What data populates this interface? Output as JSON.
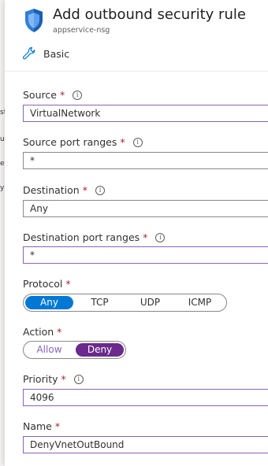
{
  "background_fragments": [
    "st",
    "u",
    "er",
    "y"
  ],
  "header": {
    "title": "Add outbound security rule",
    "subtitle": "appservice-nsg",
    "tab_label": "Basic"
  },
  "fields": {
    "source": {
      "label": "Source",
      "required": "*",
      "info": "i",
      "value": "VirtualNetwork"
    },
    "source_port_ranges": {
      "label": "Source port ranges",
      "required": "*",
      "info": "i",
      "value": "*"
    },
    "destination": {
      "label": "Destination",
      "required": "*",
      "info": "i",
      "value": "Any"
    },
    "destination_port_ranges": {
      "label": "Destination port ranges",
      "required": "*",
      "info": "i",
      "value": "*"
    },
    "protocol": {
      "label": "Protocol",
      "required": "*",
      "options": [
        "Any",
        "TCP",
        "UDP",
        "ICMP"
      ],
      "selected": "Any"
    },
    "action": {
      "label": "Action",
      "required": "*",
      "options": [
        "Allow",
        "Deny"
      ],
      "selected": "Deny"
    },
    "priority": {
      "label": "Priority",
      "required": "*",
      "info": "i",
      "value": "4096"
    },
    "name": {
      "label": "Name",
      "required": "*",
      "value": "DenyVnetOutBound"
    }
  },
  "colors": {
    "accent_blue": "#0078d4",
    "accent_purple": "#6b2a8c",
    "focus_border": "#8764b8",
    "required": "#a4262c"
  }
}
